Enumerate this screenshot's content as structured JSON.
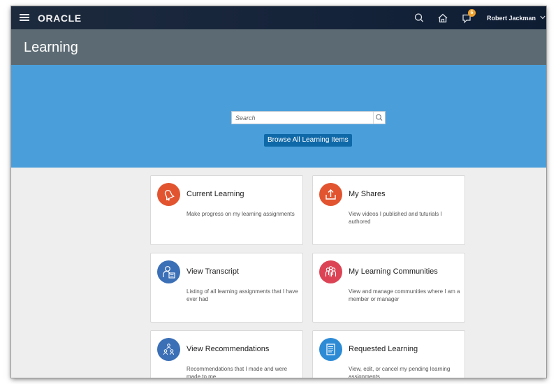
{
  "header": {
    "brand": "ORACLE",
    "notification_count": "6",
    "user_name": "Robert Jackman",
    "icons": [
      "menu-icon",
      "search-icon",
      "home-icon",
      "notifications-icon",
      "chevron-down-icon"
    ]
  },
  "page": {
    "title": "Learning"
  },
  "hero": {
    "search_placeholder": "Search",
    "browse_label": "Browse All Learning Items"
  },
  "cards": [
    {
      "title": "Current Learning",
      "description": "Make progress on my learning assignments",
      "icon": "bell-icon",
      "color": "#e2542f"
    },
    {
      "title": "My Shares",
      "description": "View videos I published and tuturials I authored",
      "icon": "upload-icon",
      "color": "#e2542f"
    },
    {
      "title": "View Transcript",
      "description": "Listing of all learning assignments that I have ever had",
      "icon": "transcript-icon",
      "color": "#3b6fb6"
    },
    {
      "title": "My Learning Communities",
      "description": "View and manage communities where I am a member or manager",
      "icon": "community-icon",
      "color": "#dc4455"
    },
    {
      "title": "View Recommendations",
      "description": "Recommendations that I made and were made to me",
      "icon": "recommendations-icon",
      "color": "#3b6fb6"
    },
    {
      "title": "Requested Learning",
      "description": "View, edit, or cancel my pending learning assignments",
      "icon": "document-icon",
      "color": "#2d8bd6"
    }
  ],
  "colors": {
    "topbar": "#15233a",
    "titlebar": "#5c6b73",
    "hero": "#4a9fdb",
    "button": "#0f69a8",
    "badge": "#f0a12c"
  }
}
